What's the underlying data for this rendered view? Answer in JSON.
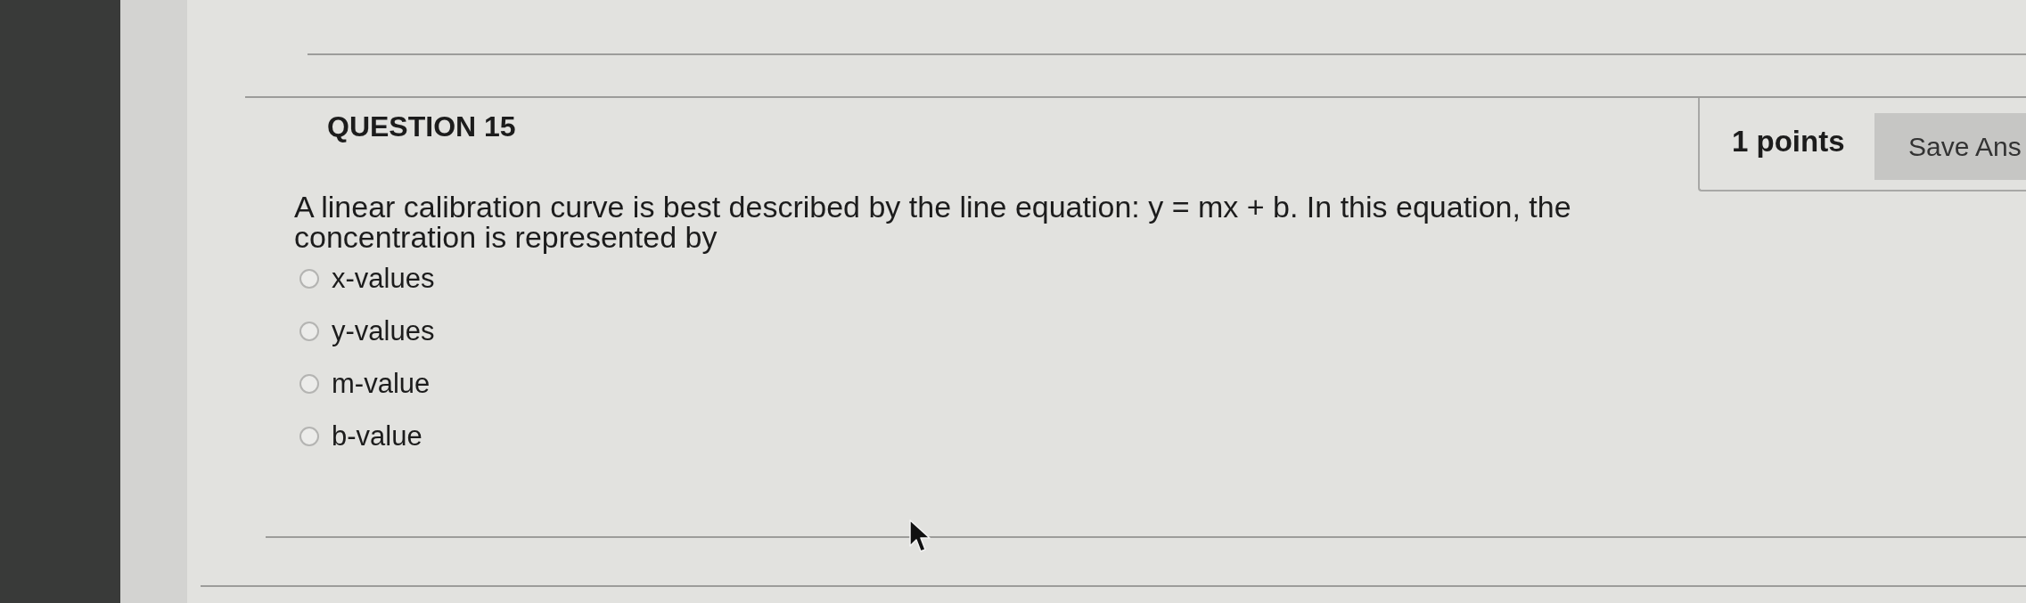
{
  "question": {
    "title": "QUESTION 15",
    "points": "1 points",
    "save_button": "Save Ans",
    "text": "A linear calibration curve is best described by the line equation: y = mx + b. In this equation, the concentration is represented by",
    "options": [
      {
        "label": "x-values",
        "selected": false
      },
      {
        "label": "y-values",
        "selected": false
      },
      {
        "label": "m-value",
        "selected": false
      },
      {
        "label": "b-value",
        "selected": false
      }
    ]
  }
}
